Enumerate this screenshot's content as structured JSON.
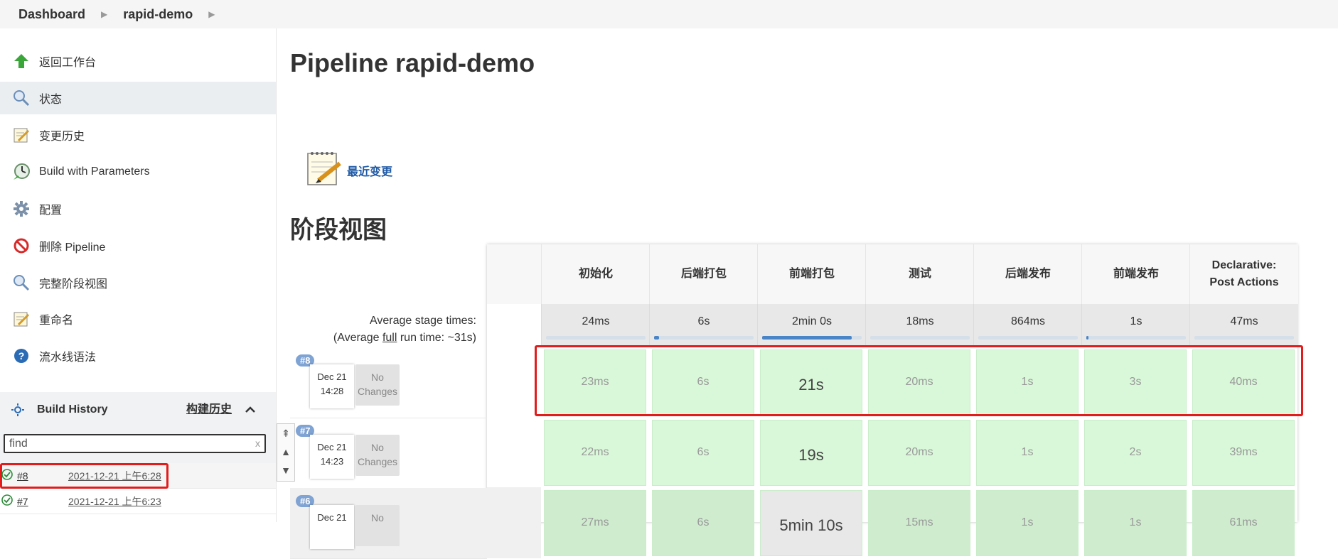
{
  "breadcrumb": {
    "items": [
      "Dashboard",
      "rapid-demo"
    ]
  },
  "sidebar": {
    "items": [
      {
        "label": "返回工作台",
        "icon": "arrow-up-icon"
      },
      {
        "label": "状态",
        "icon": "search-icon"
      },
      {
        "label": "变更历史",
        "icon": "notepad-icon"
      },
      {
        "label": "Build with Parameters",
        "icon": "build-clock-icon"
      },
      {
        "label": "配置",
        "icon": "gear-icon"
      },
      {
        "label": "删除 Pipeline",
        "icon": "no-entry-icon"
      },
      {
        "label": "完整阶段视图",
        "icon": "search-icon"
      },
      {
        "label": "重命名",
        "icon": "notepad-icon"
      },
      {
        "label": "流水线语法",
        "icon": "help-icon"
      }
    ]
  },
  "build_history": {
    "title": "Build History",
    "trend_link": "构建历史",
    "find_placeholder": "find",
    "find_clear": "x",
    "builds": [
      {
        "number": "#8",
        "datetime": "2021-12-21 上午6:28",
        "status": "success"
      },
      {
        "number": "#7",
        "datetime": "2021-12-21 上午6:23",
        "status": "success"
      }
    ]
  },
  "main": {
    "title": "Pipeline rapid-demo",
    "recent_changes": "最近变更",
    "stage_view_title": "阶段视图",
    "avg_stage_label": "Average stage times:",
    "avg_full_prefix": "(Average ",
    "avg_full_word": "full",
    "avg_full_suffix": " run time: ~31s)"
  },
  "stage_view": {
    "stages": [
      {
        "name": "初始化",
        "avg": "24ms",
        "avg_fraction": 0.0
      },
      {
        "name": "后端打包",
        "avg": "6s",
        "avg_fraction": 0.05
      },
      {
        "name": "前端打包",
        "avg": "2min 0s",
        "avg_fraction": 0.9
      },
      {
        "name": "测试",
        "avg": "18ms",
        "avg_fraction": 0.0
      },
      {
        "name": "后端发布",
        "avg": "864ms",
        "avg_fraction": 0.0
      },
      {
        "name": "前端发布",
        "avg": "1s",
        "avg_fraction": 0.02
      },
      {
        "name": "Declarative: Post Actions",
        "avg": "47ms",
        "avg_fraction": 0.0
      }
    ],
    "builds": [
      {
        "badge": "#8",
        "date": "Dec 21",
        "time": "14:28",
        "changes": "No Changes",
        "times": [
          "23ms",
          "6s",
          "21s",
          "20ms",
          "1s",
          "3s",
          "40ms"
        ]
      },
      {
        "badge": "#7",
        "date": "Dec 21",
        "time": "14:23",
        "changes": "No Changes",
        "times": [
          "22ms",
          "6s",
          "19s",
          "20ms",
          "1s",
          "2s",
          "39ms"
        ]
      },
      {
        "badge": "#6",
        "date": "Dec 21",
        "time": "",
        "changes": "No",
        "times": [
          "27ms",
          "6s",
          "5min 10s",
          "15ms",
          "1s",
          "1s",
          "61ms"
        ]
      }
    ]
  },
  "colors": {
    "success_cell": "#d9f7d9",
    "accent_link": "#1f5aa6",
    "highlight_box": "#e21b1b"
  }
}
